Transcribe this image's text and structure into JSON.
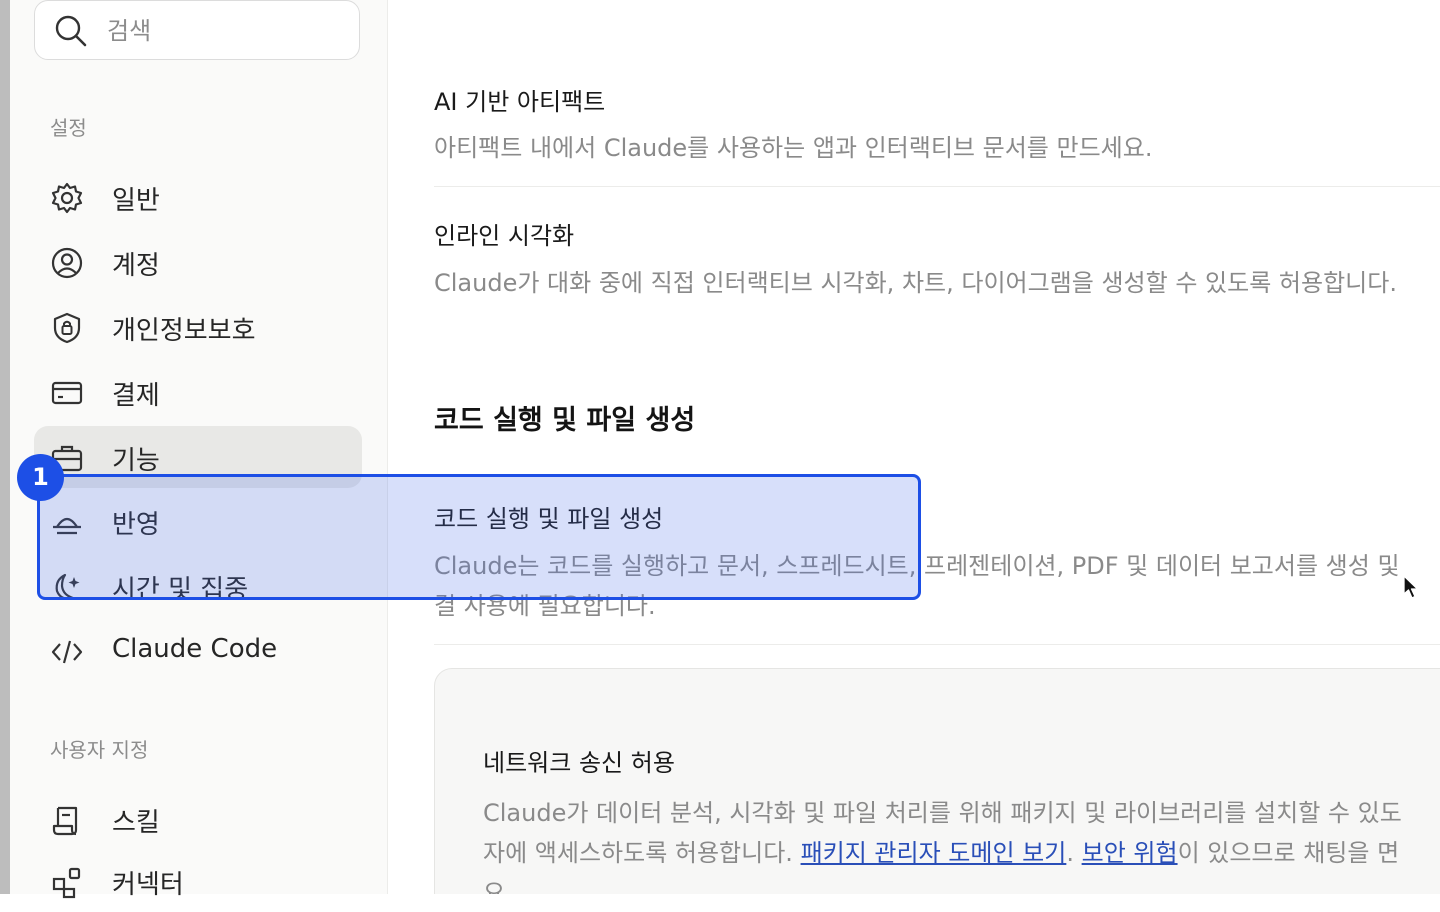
{
  "sidebar": {
    "search": {
      "placeholder": "검색"
    },
    "section_settings": "설정",
    "items": [
      {
        "label": "일반",
        "icon": "gear-icon"
      },
      {
        "label": "계정",
        "icon": "user-circle-icon"
      },
      {
        "label": "개인정보보호",
        "icon": "shield-lock-icon"
      },
      {
        "label": "결제",
        "icon": "credit-card-icon"
      },
      {
        "label": "기능",
        "icon": "briefcase-icon",
        "active": true
      },
      {
        "label": "반영",
        "icon": "sunrise-icon"
      },
      {
        "label": "시간 및 집중",
        "icon": "moon-sparkle-icon"
      },
      {
        "label": "Claude Code",
        "icon": "code-icon"
      }
    ],
    "section_custom": "사용자 지정",
    "custom_items": [
      {
        "label": "스킬",
        "icon": "scroll-icon"
      },
      {
        "label": "커넥터",
        "icon": "connector-icon"
      }
    ]
  },
  "main": {
    "artifacts": {
      "title": "AI 기반 아티팩트",
      "description": "아티팩트 내에서 Claude를 사용하는 앱과 인터랙티브 문서를 만드세요."
    },
    "inline_visual": {
      "title": "인라인 시각화",
      "description": "Claude가 대화 중에 직접 인터랙티브 시각화, 차트, 다이어그램을 생성할 수 있도록 허용합니다."
    },
    "section_heading": "코드 실행 및 파일 생성",
    "code_exec": {
      "title": "코드 실행 및 파일 생성",
      "description_line1": "Claude는 코드를 실행하고 문서, 스프레드시트, 프레젠테이션, PDF 및 데이터 보고서를 생성 및",
      "description_line2": "결 사용에 필요합니다."
    },
    "network": {
      "title": "네트워크 송신 허용",
      "line1": "Claude가 데이터 분석, 시각화 및 파일 처리를 위해 패키지 및 라이브러리를 설치할 수 있도",
      "line2_prefix": "자에 액세스하도록 허용합니다. ",
      "link_domains": "패키지 관리자 도메인 보기",
      "line2_sep": ". ",
      "link_risks": "보안 위험",
      "line2_suffix": "이 있으므로 채팅을 면",
      "line3": "요."
    }
  },
  "overlay": {
    "step_number": "1",
    "color": "#1d4fe6"
  }
}
